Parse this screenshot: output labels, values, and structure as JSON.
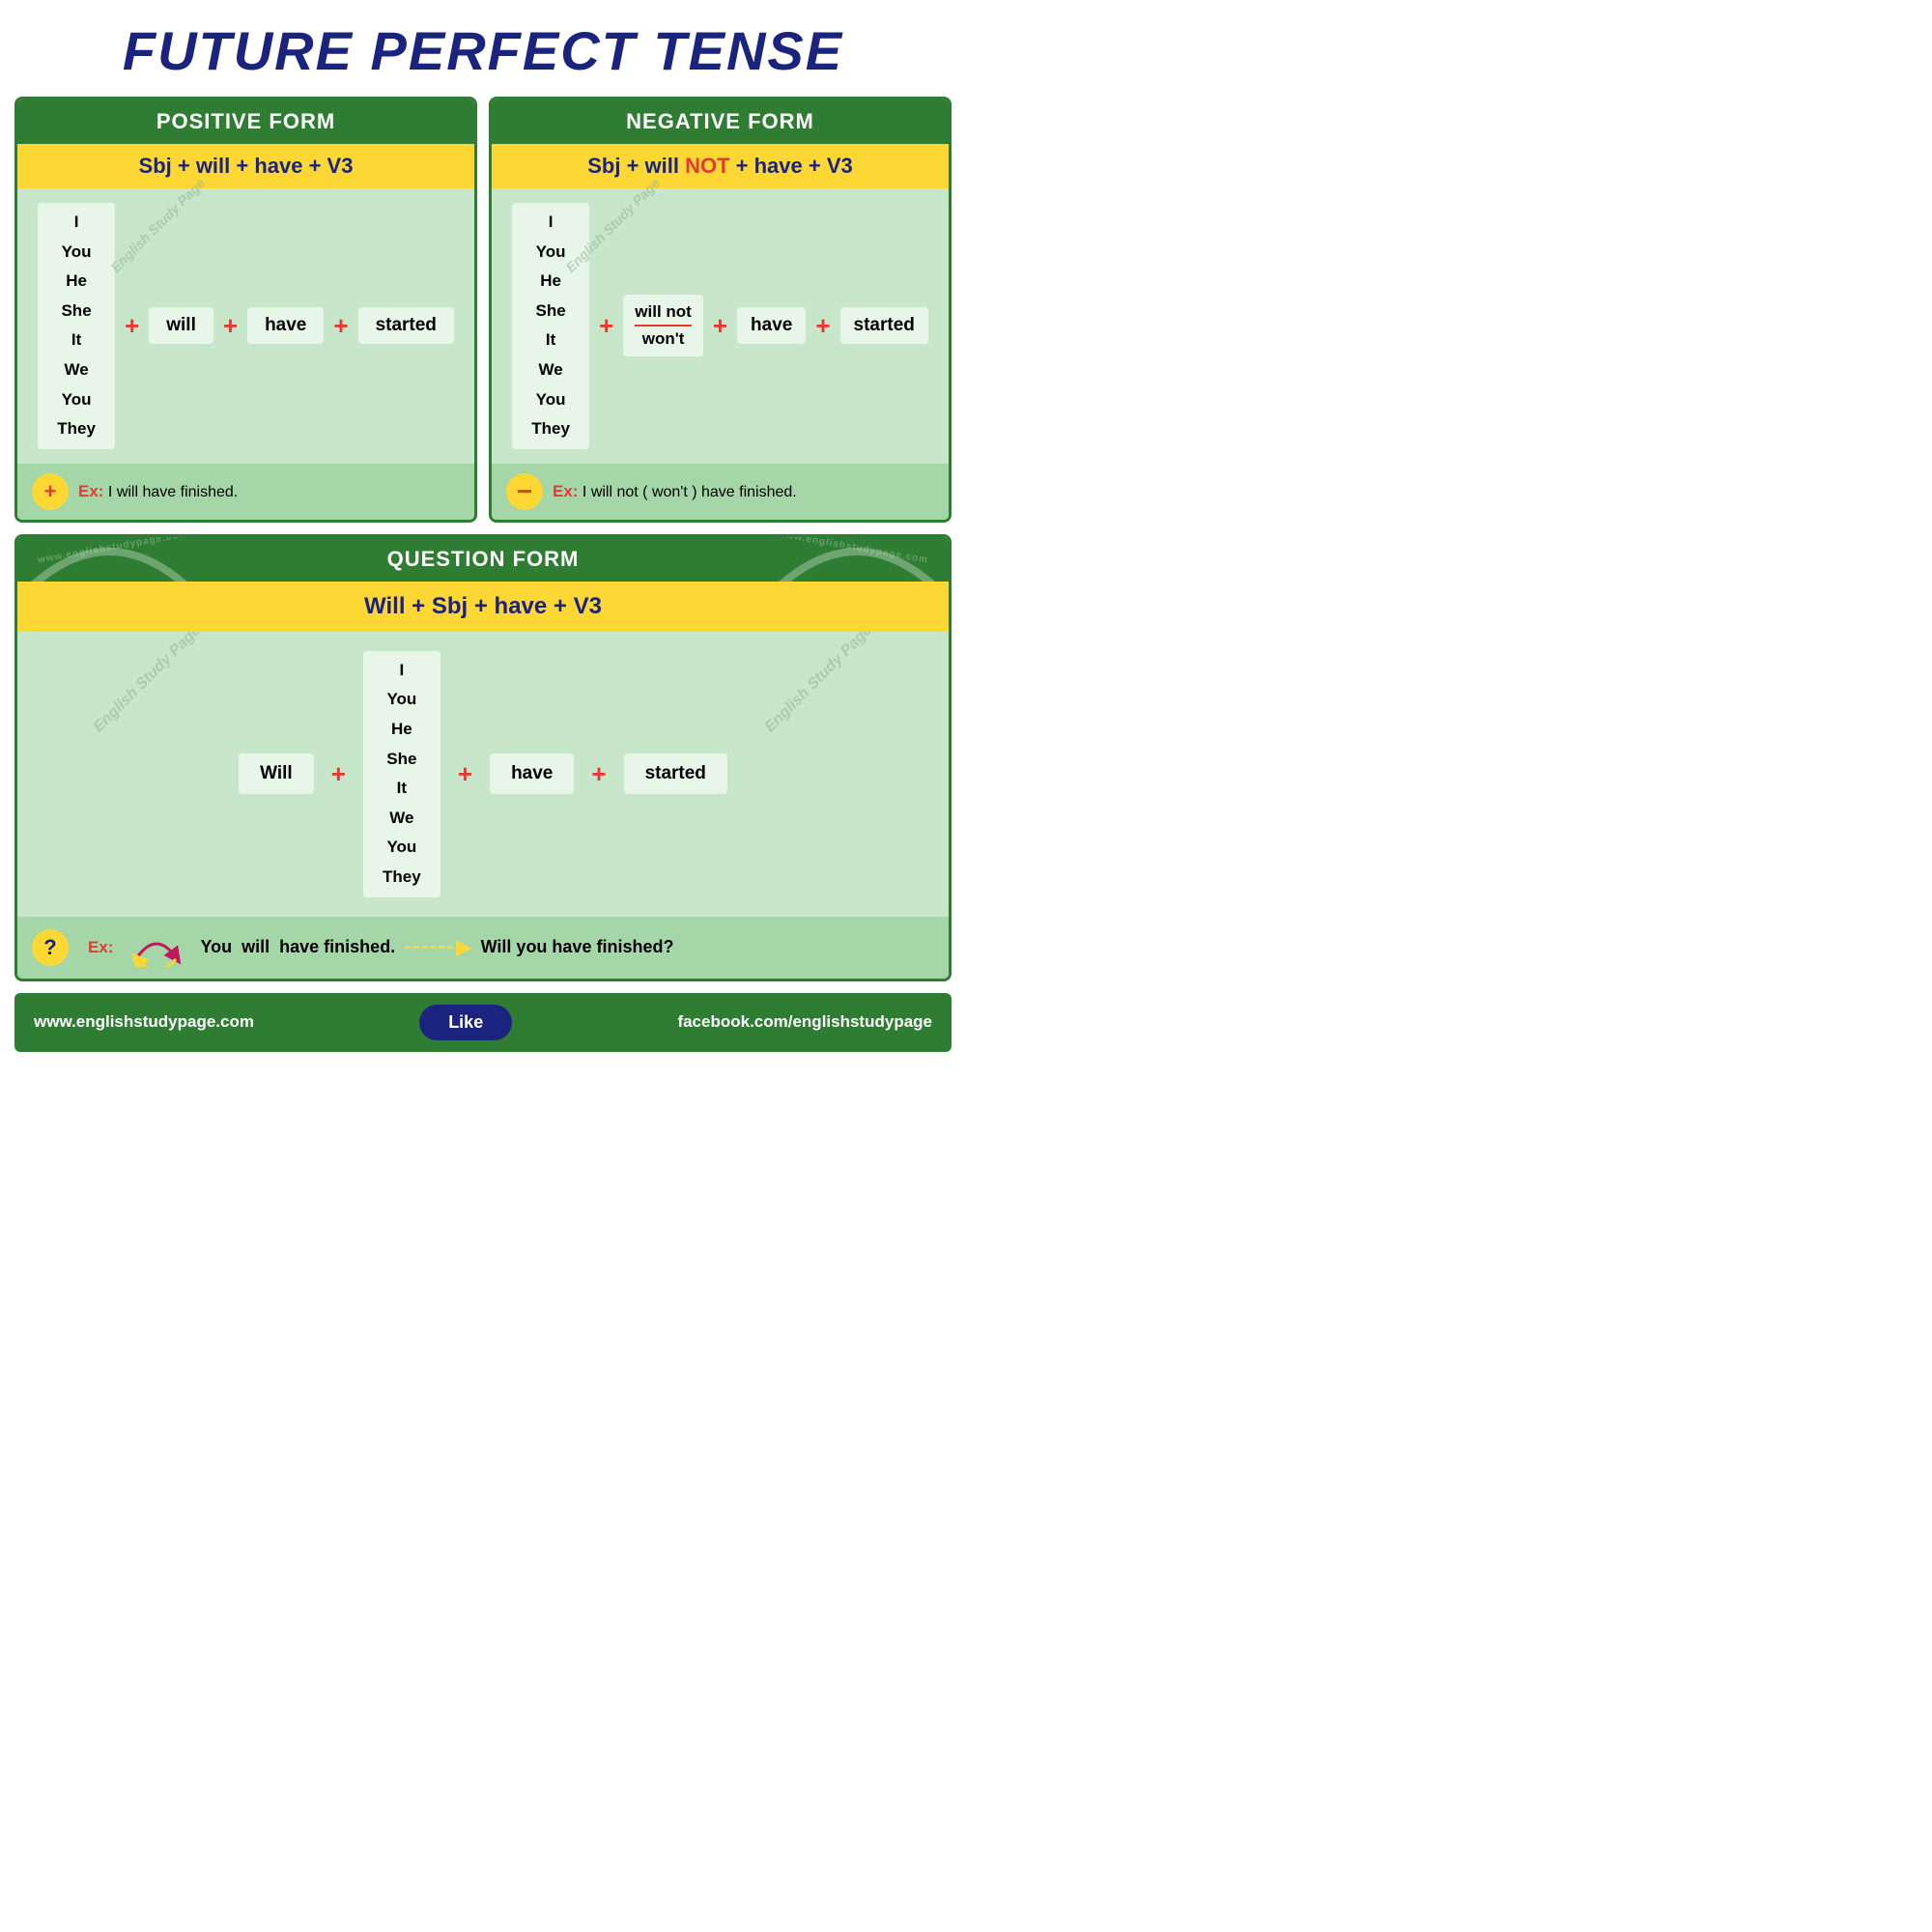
{
  "title": "FUTURE PERFECT TENSE",
  "positive": {
    "header": "POSITIVE FORM",
    "formula": "Sbj + will + have + V3",
    "pronouns": [
      "I",
      "You",
      "He",
      "She",
      "It",
      "We",
      "You",
      "They"
    ],
    "will": "will",
    "have": "have",
    "v3": "started",
    "example_label": "Ex:",
    "example_text": "I will have finished."
  },
  "negative": {
    "header": "NEGATIVE FORM",
    "formula_pre": "Sbj + will ",
    "formula_not": "NOT",
    "formula_post": " + have + V3",
    "pronouns": [
      "I",
      "You",
      "He",
      "She",
      "It",
      "We",
      "You",
      "They"
    ],
    "will_not": "will not",
    "wont": "won't",
    "have": "have",
    "v3": "started",
    "example_label": "Ex:",
    "example_text": "I will not ( won't ) have finished."
  },
  "question": {
    "header": "QUESTION FORM",
    "formula": "Will +  Sbj + have + V3",
    "pronouns": [
      "I",
      "You",
      "He",
      "She",
      "It",
      "We",
      "You",
      "They"
    ],
    "will": "Will",
    "have": "have",
    "v3": "started",
    "example_label": "Ex:",
    "example_you": "You",
    "example_will": "will",
    "example_rest": "have finished.",
    "example_arrow": "——▶",
    "example_result": "Will you have finished?"
  },
  "watermark": "English Study Page",
  "watermark2": "www.englishstudypage.com",
  "footer": {
    "left": "www.englishstudypage.com",
    "like": "Like",
    "right": "facebook.com/englishstudypage"
  }
}
